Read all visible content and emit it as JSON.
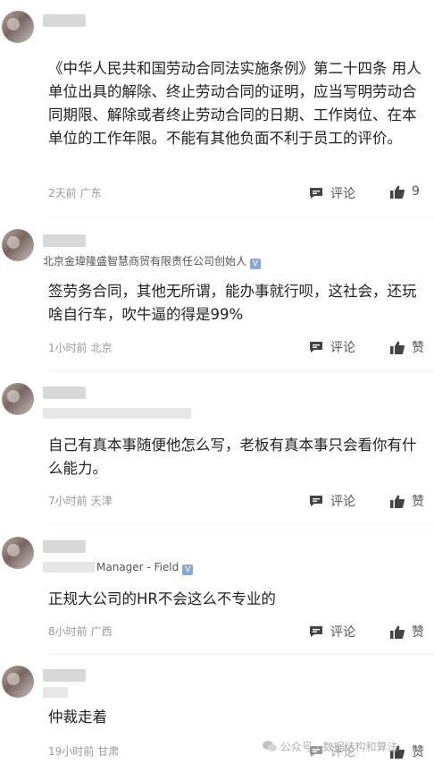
{
  "comments": [
    {
      "subtitle": "",
      "text": "《中华人民共和国劳动合同法实施条例》第二十四条 用人单位出具的解除、终止劳动合同的证明，应当写明劳动合同期限、解除或者终止劳动合同的日期、工作岗位、在本单位的工作年限。不能有其他负面不利于员工的评价。",
      "time": "2天前",
      "location": "广东",
      "comment_label": "评论",
      "like_label": "9"
    },
    {
      "subtitle": "北京金瑋隆盛智慧商贸有限责任公司创始人",
      "text": "签劳务合同，其他无所谓，能办事就行呗，这社会，还玩啥自行车，吹牛逼的得是99%",
      "time": "1小时前",
      "location": "北京",
      "comment_label": "评论",
      "like_label": "赞"
    },
    {
      "subtitle": "",
      "text": "自己有真本事随便他怎么写，老板有真本事只会看你有什么能力。",
      "time": "7小时前",
      "location": "天津",
      "comment_label": "评论",
      "like_label": "赞"
    },
    {
      "subtitle": "Manager - Field",
      "text": "正规大公司的HR不会这么不专业的",
      "time": "8小时前",
      "location": "广西",
      "comment_label": "评论",
      "like_label": "赞"
    },
    {
      "subtitle": "",
      "text": "仲裁走着",
      "time": "19小时前",
      "location": "甘肃",
      "comment_label": "评论",
      "like_label": "赞"
    }
  ],
  "watermark": "公众号 · 数据结构和算法",
  "badge_letter": "V",
  "colors": {
    "text": "#222222",
    "meta": "#9a9a9a",
    "action": "#555555",
    "badge": "#8aa7d6"
  }
}
